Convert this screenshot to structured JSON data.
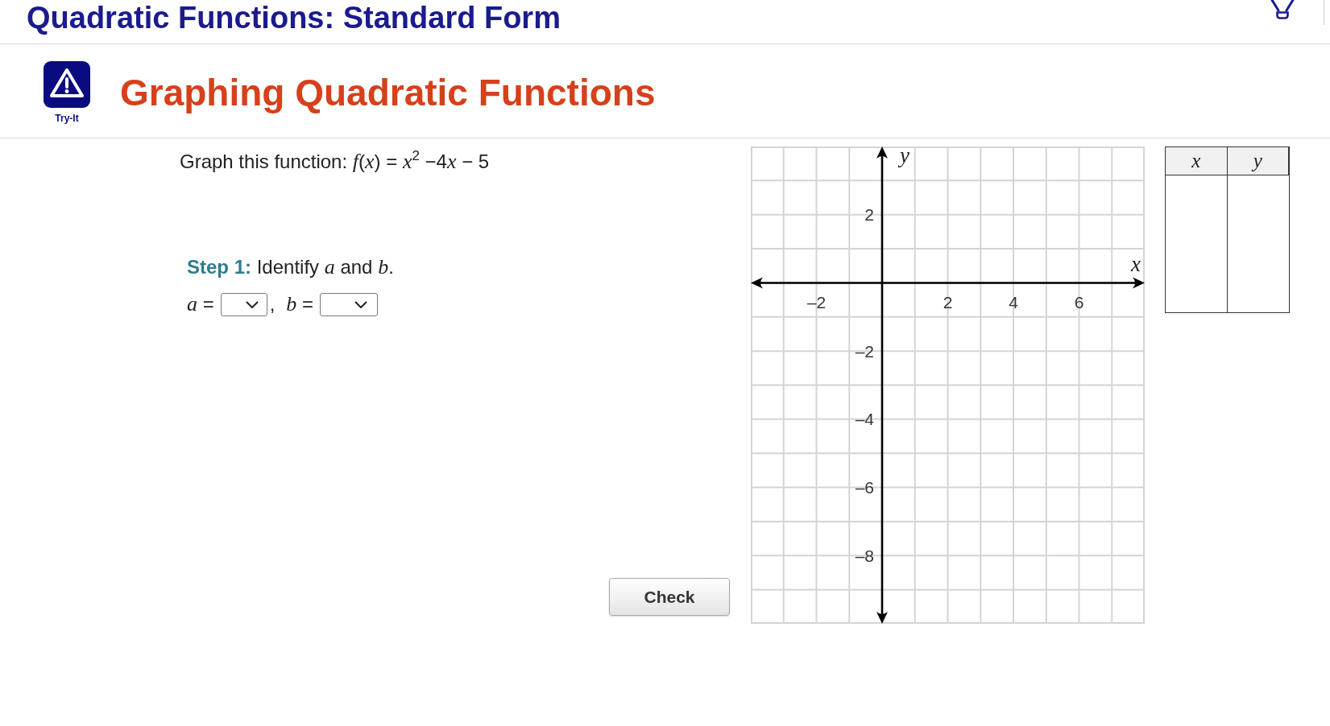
{
  "header": {
    "title": "Quadratic Functions: Standard Form"
  },
  "activity": {
    "badge_label": "Try-It",
    "title": "Graphing Quadratic Functions"
  },
  "question": {
    "prompt": [
      "Graph this function: *f*(*x*) = *x*$^{2}$ −4",
      "*x* − 5"
    ],
    "step": "**Step 1:** Identify *a* and *b*.",
    "selects": [
      {
        "label": "*a* =",
        "after": ","
      },
      {
        "label": "*b* ="
      }
    ],
    "check_button": "Check"
  },
  "graph": {
    "chart_data": {
      "type": "scatter",
      "xlabel": "x",
      "ylabel": "y",
      "xlim": [
        -4,
        8
      ],
      "ylim": [
        -10,
        4
      ],
      "xticks": [
        {
          "value": -2,
          "label": "–2"
        },
        2,
        4,
        6
      ],
      "yticks": [
        {
          "value": -8,
          "label": "–8"
        },
        {
          "value": -6,
          "label": "–6"
        },
        {
          "value": -4,
          "label": "–4"
        },
        {
          "value": -2,
          "label": "–2"
        },
        2
      ],
      "grid": true
    }
  },
  "table": {
    "columns": [
      "x",
      "y"
    ]
  }
}
